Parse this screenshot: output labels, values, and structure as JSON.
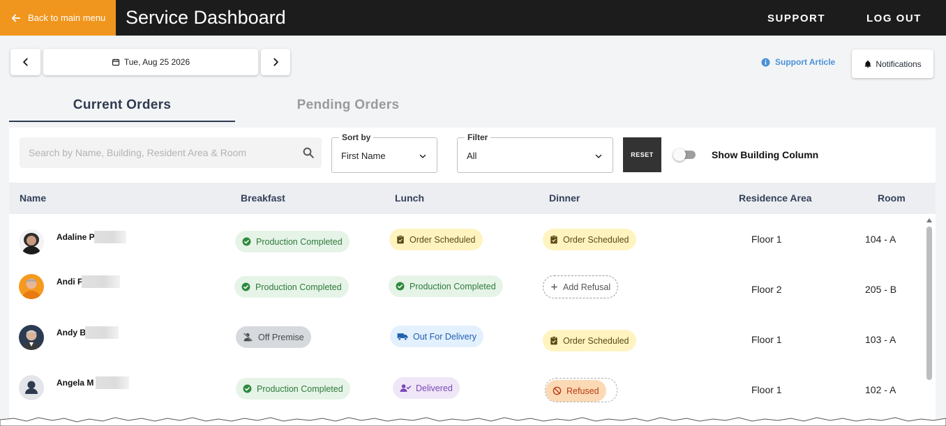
{
  "header": {
    "back_label": "Back to main menu",
    "title": "Service Dashboard",
    "support_label": "SUPPORT",
    "logout_label": "LOG OUT"
  },
  "date_bar": {
    "date": "Tue, Aug 25 2026"
  },
  "support_article_label": "Support Article",
  "notifications_label": "Notifications",
  "tabs": [
    {
      "label": "Current Orders",
      "active": true
    },
    {
      "label": "Pending Orders",
      "active": false
    }
  ],
  "filters": {
    "search_placeholder": "Search by Name, Building, Resident Area & Room",
    "sort_legend": "Sort by",
    "sort_value": "First Name",
    "filter_legend": "Filter",
    "filter_value": "All",
    "reset_label": "RESET",
    "toggle_label": "Show Building Column",
    "toggle_on": false
  },
  "columns": [
    "Name",
    "Breakfast",
    "Lunch",
    "Dinner",
    "Residence Area",
    "Room"
  ],
  "rows": [
    {
      "name": "Adaline P",
      "breakfast": "Production Completed",
      "lunch": "Order Scheduled",
      "dinner": "Order Scheduled",
      "area": "Floor 1",
      "room": "104 - A"
    },
    {
      "name": "Andi F",
      "breakfast": "Production Completed",
      "lunch": "Production Completed",
      "dinner": "Add Refusal",
      "area": "Floor 2",
      "room": "205 - B"
    },
    {
      "name": "Andy B",
      "breakfast": "Off Premise",
      "lunch": "Out For Delivery",
      "dinner": "Order Scheduled",
      "area": "Floor 1",
      "room": "103 - A"
    },
    {
      "name": "Angela M",
      "breakfast": "Production Completed",
      "lunch": "Delivered",
      "dinner": "Refused",
      "area": "Floor 1",
      "room": "102 - A"
    }
  ],
  "colors": {
    "accent_orange": "#f0961e",
    "topbar": "#1c1c1c",
    "tab_active": "#2e3a4f",
    "link_blue": "#4a90d9"
  }
}
